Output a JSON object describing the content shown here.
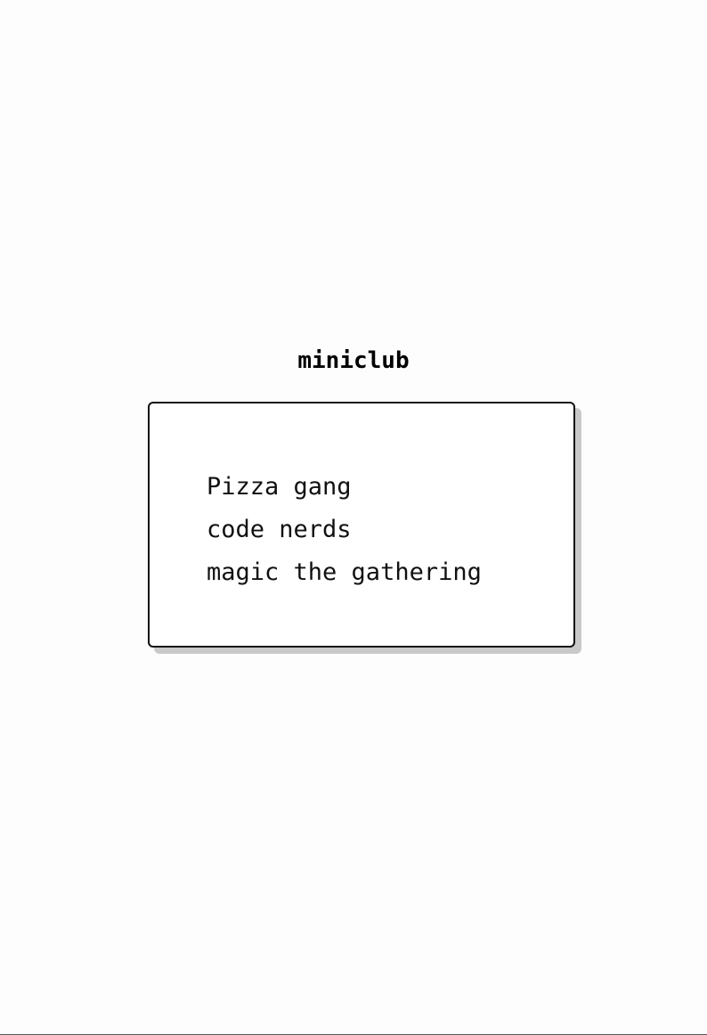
{
  "header": {
    "logo_text": "miniclub"
  },
  "clubs": [
    {
      "label": "Pizza gang"
    },
    {
      "label": "code nerds"
    },
    {
      "label": "magic the gathering"
    }
  ],
  "colors": {
    "background": "#fdfdfd",
    "text": "#111111",
    "card_border": "#111111",
    "card_shadow": "#c9c9c9"
  }
}
